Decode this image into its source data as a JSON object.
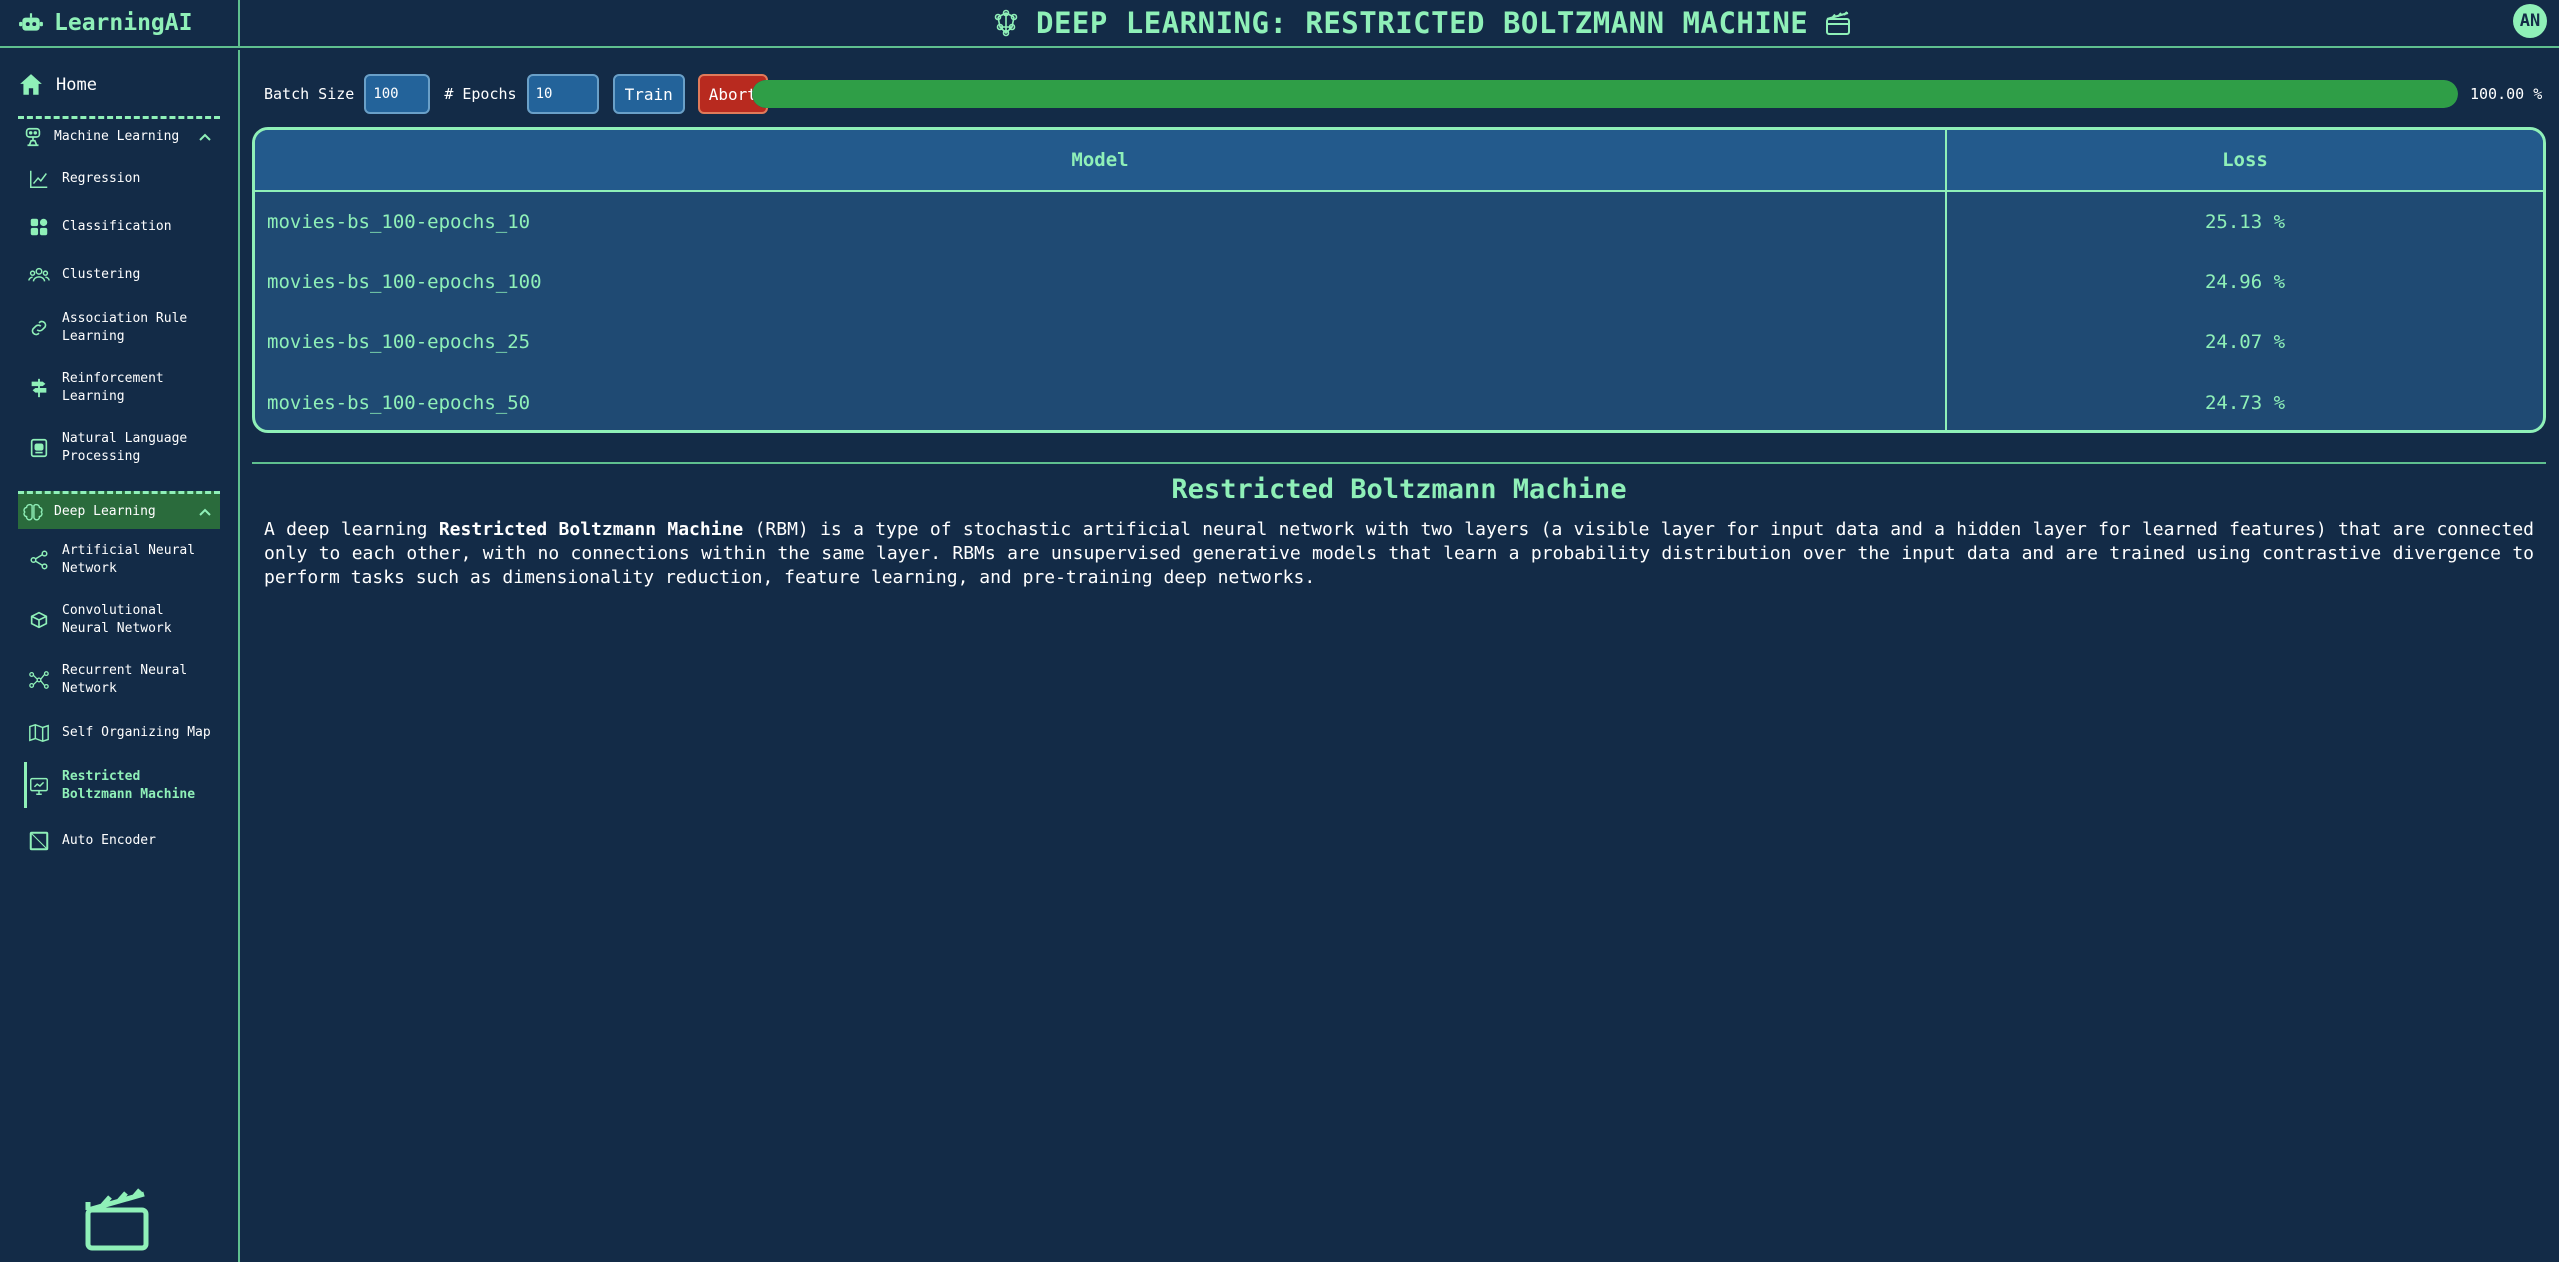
{
  "app": {
    "brand": "LearningAI",
    "avatar_initials": "AN"
  },
  "header": {
    "title": "DEEP LEARNING: RESTRICTED BOLTZMANN MACHINE"
  },
  "sidebar": {
    "home": "Home",
    "ml_group": {
      "label": "Machine Learning",
      "items": [
        "Regression",
        "Classification",
        "Clustering",
        "Association Rule Learning",
        "Reinforcement Learning",
        "Natural Language Processing"
      ]
    },
    "dl_group": {
      "label": "Deep Learning",
      "items": [
        "Artificial Neural Network",
        "Convolutional Neural Network",
        "Recurrent Neural Network",
        "Self Organizing Map",
        "Restricted Boltzmann Machine",
        "Auto Encoder"
      ],
      "active": "Restricted Boltzmann Machine"
    }
  },
  "controls": {
    "batch_size_label": "Batch Size",
    "batch_size_value": "100",
    "epochs_label": "# Epochs",
    "epochs_value": "10",
    "train_label": "Train",
    "abort_label": "Abort",
    "progress": 1.0,
    "progress_text": "100.00 %"
  },
  "table": {
    "columns": [
      "Model",
      "Loss"
    ],
    "rows": [
      {
        "model": "movies-bs_100-epochs_10",
        "loss": "25.13 %"
      },
      {
        "model": "movies-bs_100-epochs_100",
        "loss": "24.96 %"
      },
      {
        "model": "movies-bs_100-epochs_25",
        "loss": "24.07 %"
      },
      {
        "model": "movies-bs_100-epochs_50",
        "loss": "24.73 %"
      }
    ]
  },
  "description": {
    "title": "Restricted Boltzmann Machine",
    "prefix": "A deep learning ",
    "bold": "Restricted Boltzmann Machine",
    "body": " (RBM) is a type of stochastic artificial neural network with two layers (a visible layer for input data and a hidden layer for learned features) that are connected only to each other, with no connections within the same layer. RBMs are unsupervised generative models that learn a probability distribution over the input data and are trained using contrastive divergence to perform tasks such as dimensionality reduction, feature learning, and pre-training deep networks."
  },
  "colors": {
    "background": "#132b47",
    "accent": "#8ff0b8",
    "table_bg": "#1f4a73",
    "progress_fill": "#2f9e47",
    "abort_red": "#b82a1f",
    "active_group_bg": "#2a6b3c"
  },
  "icons": {
    "brand": "robot-icon",
    "title_left": "brain-network-icon",
    "title_right": "clapperboard-icon",
    "home": "home-icon",
    "ml_group": "robot-arm-icon",
    "dl_group": "brain-icon",
    "regression": "line-chart-icon",
    "classification": "grid-icon",
    "clustering": "users-cluster-icon",
    "association": "link-icon",
    "reinforcement": "signpost-icon",
    "nlp": "document-robot-icon",
    "ann": "share-nodes-icon",
    "cnn": "layers-box-icon",
    "rnn": "network-icon",
    "som": "map-icon",
    "rbm": "monitor-chart-icon",
    "autoencoder": "square-icon",
    "bottom_logo": "clapperboard-icon"
  }
}
